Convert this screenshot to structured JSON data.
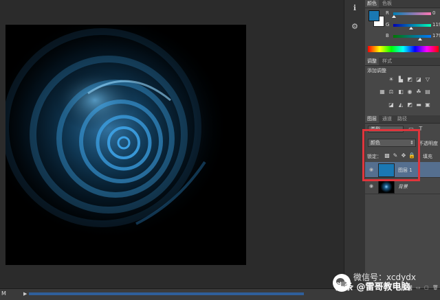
{
  "iconstrip": {
    "items": [
      {
        "icon": "info-panel-icon"
      },
      {
        "icon": "clone-source-icon"
      }
    ]
  },
  "color_panel": {
    "tabs": [
      {
        "label": "颜色",
        "active": true
      },
      {
        "label": "色板",
        "active": false
      }
    ],
    "foreground_color": "#1a78b3",
    "background_color": "#ffffff",
    "channels": [
      {
        "label": "R",
        "value": "0",
        "fraction": 0.0
      },
      {
        "label": "G",
        "value": "119",
        "fraction": 0.467
      },
      {
        "label": "B",
        "value": "179",
        "fraction": 0.702
      }
    ]
  },
  "adjustments_panel": {
    "tabs": [
      {
        "label": "调整",
        "active": true
      },
      {
        "label": "样式",
        "active": false
      }
    ],
    "heading": "添加调整"
  },
  "layers_panel": {
    "tabs": [
      {
        "label": "图层",
        "active": true
      },
      {
        "label": "通道",
        "active": false
      },
      {
        "label": "路径",
        "active": false
      }
    ],
    "filter_label": "类型",
    "blend_mode": "颜色",
    "opacity_label": "不透明度",
    "lock_label": "锁定：",
    "fill_label": "填充",
    "layers": [
      {
        "name": "图层 1",
        "selected": true,
        "thumb_color": "#1a78b3"
      },
      {
        "name": "背景",
        "selected": false,
        "thumb_color": "#000000"
      }
    ]
  },
  "status_bar": {
    "zoom_text": "M"
  },
  "watermark": {
    "line1": "微信号：xcdydx",
    "line2": "头条 @雷哥教电脑"
  },
  "colors": {
    "highlight": "#e0353c",
    "selected_layer_bg": "#556f8f",
    "panel_bg": "#474747"
  }
}
